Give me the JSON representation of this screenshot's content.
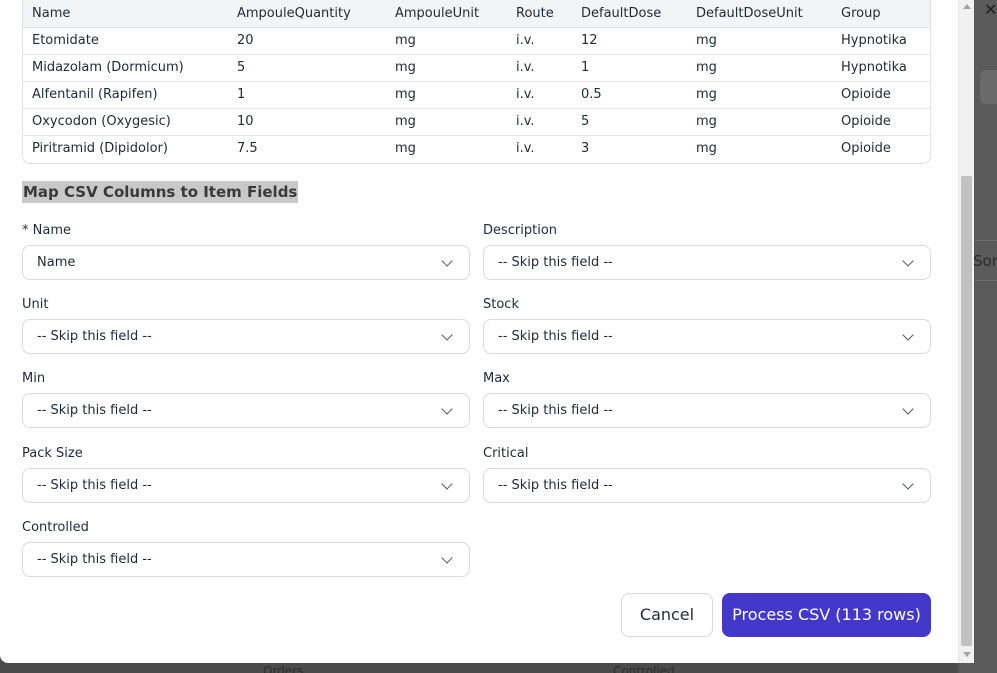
{
  "preview": {
    "columns": [
      "Name",
      "AmpouleQuantity",
      "AmpouleUnit",
      "Route",
      "DefaultDose",
      "DefaultDoseUnit",
      "Group"
    ],
    "rows": [
      [
        "Etomidate",
        "20",
        "mg",
        "i.v.",
        "12",
        "mg",
        "Hypnotika"
      ],
      [
        "Midazolam (Dormicum)",
        "5",
        "mg",
        "i.v.",
        "1",
        "mg",
        "Hypnotika"
      ],
      [
        "Alfentanil (Rapifen)",
        "1",
        "mg",
        "i.v.",
        "0.5",
        "mg",
        "Opioide"
      ],
      [
        "Oxycodon (Oxygesic)",
        "10",
        "mg",
        "i.v.",
        "5",
        "mg",
        "Opioide"
      ],
      [
        "Piritramid (Dipidolor)",
        "7.5",
        "mg",
        "i.v.",
        "3",
        "mg",
        "Opioide"
      ]
    ]
  },
  "mapping": {
    "title": "Map CSV Columns to Item Fields",
    "fields": [
      {
        "label": "* Name",
        "value": "Name"
      },
      {
        "label": "Description",
        "value": "-- Skip this field --"
      },
      {
        "label": "Unit",
        "value": "-- Skip this field --"
      },
      {
        "label": "Stock",
        "value": "-- Skip this field --"
      },
      {
        "label": "Min",
        "value": "-- Skip this field --"
      },
      {
        "label": "Max",
        "value": "-- Skip this field --"
      },
      {
        "label": "Pack Size",
        "value": "-- Skip this field --"
      },
      {
        "label": "Critical",
        "value": "-- Skip this field --"
      },
      {
        "label": "Controlled",
        "value": "-- Skip this field --"
      }
    ]
  },
  "actions": {
    "cancel_label": "Cancel",
    "process_label": "Process CSV (113 rows)"
  },
  "background": {
    "close_glyph": "✕",
    "cut_text": "Sor",
    "bottom_left_text": "Orders",
    "bottom_right_text": "Controlled"
  },
  "colors": {
    "primary": "#4338ca",
    "highlight": "#c8c8c8"
  }
}
